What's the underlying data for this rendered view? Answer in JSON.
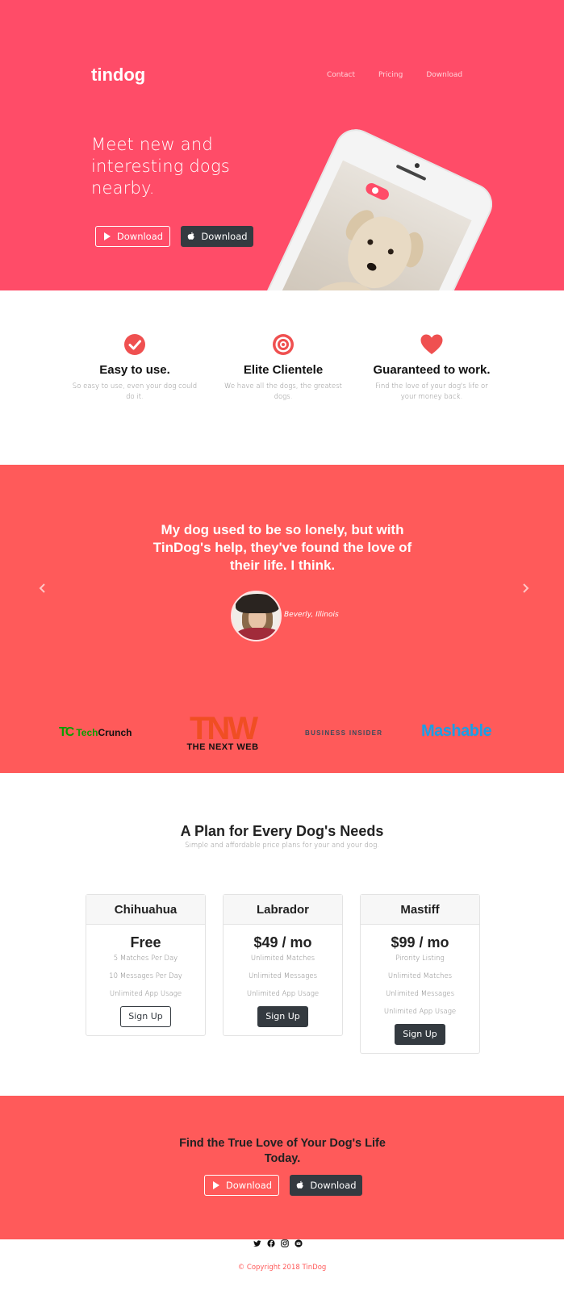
{
  "header": {
    "brand": "tindog",
    "nav": [
      "Contact",
      "Pricing",
      "Download"
    ]
  },
  "hero": {
    "title": "Meet new and interesting dogs nearby.",
    "download_google": "Download",
    "download_apple": "Download"
  },
  "features": [
    {
      "icon": "check-circle-icon",
      "title": "Easy to use.",
      "text": "So easy to use, even your dog could do it."
    },
    {
      "icon": "bullseye-icon",
      "title": "Elite Clientele",
      "text": "We have all the dogs, the greatest dogs."
    },
    {
      "icon": "heart-icon",
      "title": "Guaranteed to work.",
      "text": "Find the love of your dog's life or your money back."
    }
  ],
  "testimonial": {
    "quote": "My dog used to be so lonely, but with TinDog's help, they've found the love of their life. I think.",
    "author": "Beverly, Illinois"
  },
  "press": {
    "techcrunch_mark": "TC",
    "techcrunch_a": "Tech",
    "techcrunch_b": "Crunch",
    "tnw_mark": "TNW",
    "tnw_text": "THE NEXT WEB",
    "business_insider": "BUSINESS INSIDER",
    "mashable": "Mashable"
  },
  "pricing": {
    "title": "A Plan for Every Dog's Needs",
    "subtitle": "Simple and affordable price plans for your and your dog.",
    "plans": [
      {
        "name": "Chihuahua",
        "price": "Free",
        "features": [
          "5 Matches Per Day",
          "10 Messages Per Day",
          "Unlimited App Usage"
        ],
        "button": "Sign Up"
      },
      {
        "name": "Labrador",
        "price": "$49 / mo",
        "features": [
          "Unlimited Matches",
          "Unlimited Messages",
          "Unlimited App Usage"
        ],
        "button": "Sign Up"
      },
      {
        "name": "Mastiff",
        "price": "$99 / mo",
        "features": [
          "Pirority Listing",
          "Unlimited Matches",
          "Unlimited Messages",
          "Unlimited App Usage"
        ],
        "button": "Sign Up"
      }
    ]
  },
  "cta": {
    "title": "Find the True Love of Your Dog's Life Today.",
    "download_google": "Download",
    "download_apple": "Download"
  },
  "footer": {
    "social": [
      "twitter-icon",
      "facebook-icon",
      "instagram-icon",
      "email-icon"
    ],
    "copyright": "© Copyright 2018 TinDog"
  },
  "colors": {
    "hero_bg": "#ff4c68",
    "section_red": "#ff5a5a",
    "dark_button": "#343a40"
  }
}
